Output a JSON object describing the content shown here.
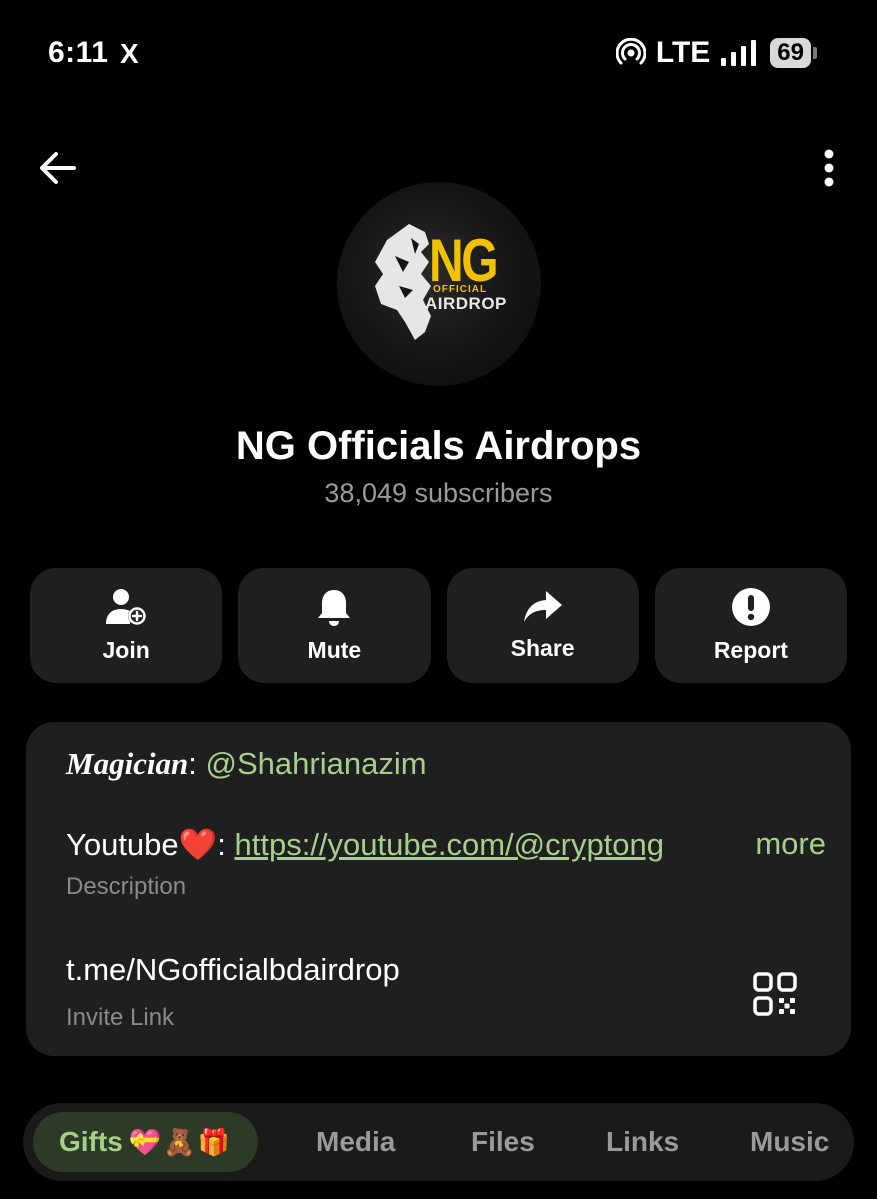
{
  "status_bar": {
    "time": "6:11",
    "app_icon": "X",
    "network": "LTE",
    "battery": "69"
  },
  "header": {
    "back_icon": "arrow-left-icon",
    "more_icon": "more-vertical-icon"
  },
  "avatar": {
    "logo_main": "NG",
    "logo_small": "OFFICIAL",
    "logo_sub": "AIRDROP"
  },
  "channel": {
    "title": "NG Officials Airdrops",
    "subscribers": "38,049 subscribers"
  },
  "actions": [
    {
      "label": "Join",
      "icon": "person-add-icon"
    },
    {
      "label": "Mute",
      "icon": "bell-icon"
    },
    {
      "label": "Share",
      "icon": "share-arrow-icon"
    },
    {
      "label": "Report",
      "icon": "alert-circle-icon"
    }
  ],
  "info": {
    "magician_label": "Magician",
    "magician_sep": ": ",
    "magician_handle": "@Shahrianazim",
    "youtube_label": "Youtube",
    "youtube_emoji": "❤️",
    "youtube_sep": ": ",
    "youtube_link": "https://youtube.com/@cryptong",
    "more": "more",
    "description_label": "Description",
    "invite_link": "t.me/NGofficialbdairdrop",
    "invite_label": "Invite Link",
    "qr_icon": "qr-code-icon"
  },
  "tabs": [
    {
      "label": "Gifts",
      "emojis": "💝🧸🎁",
      "active": true
    },
    {
      "label": "Media"
    },
    {
      "label": "Files"
    },
    {
      "label": "Links"
    },
    {
      "label": "Music"
    }
  ],
  "colors": {
    "background": "#000000",
    "card": "#1f1f1f",
    "accent_green": "#a6cf8c",
    "muted_text": "#9a9a9a",
    "logo_yellow": "#f2c200"
  }
}
